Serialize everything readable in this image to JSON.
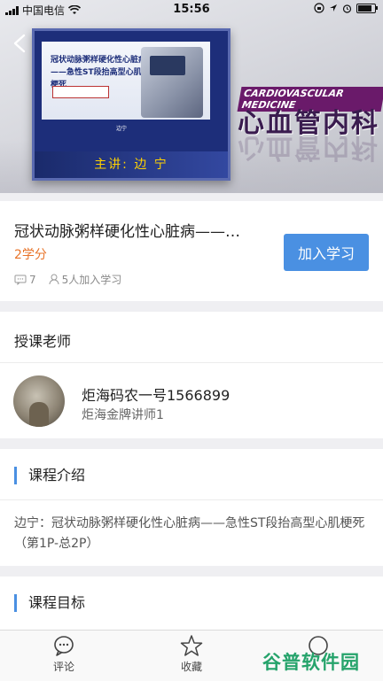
{
  "status_bar": {
    "carrier": "中国电信",
    "time": "15:56"
  },
  "hero": {
    "slide_title": "冠状动脉粥样硬化性心脏病\n——急性ST段抬高型心肌梗死",
    "slide_speaker": "边宁",
    "lecturer": "主讲: 边 宁",
    "brand_en": "CARDIOVASCULAR MEDICINE",
    "brand_cn": "心血管内科"
  },
  "course": {
    "title": "冠状动脉粥样硬化性心脏病——…",
    "credits": "2学分",
    "comments": "7",
    "learners": "5人加入学习",
    "join_label": "加入学习"
  },
  "teacher": {
    "heading": "授课老师",
    "name": "炬海码农一号1566899",
    "title": "炬海金牌讲师1"
  },
  "intro": {
    "heading": "课程介绍",
    "text": "边宁：冠状动脉粥样硬化性心脏病——急性ST段抬高型心肌梗死（第1P-总2P）"
  },
  "goal": {
    "heading": "课程目标"
  },
  "tabs": [
    {
      "label": "评论",
      "icon": "comment-icon"
    },
    {
      "label": "收藏",
      "icon": "star-icon"
    }
  ],
  "watermark": "谷普软件园",
  "colors": {
    "accent": "#4a90e2",
    "credits": "#e8742a",
    "watermark": "#25a36b"
  }
}
